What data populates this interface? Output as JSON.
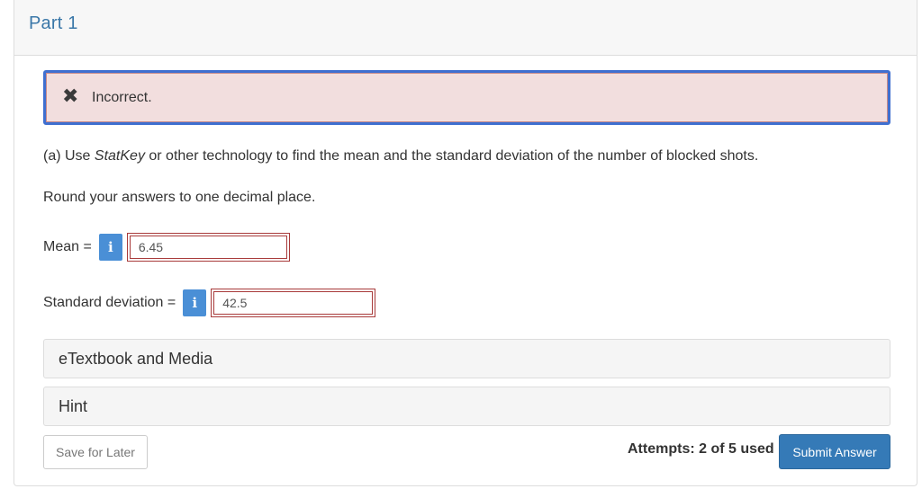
{
  "header": {
    "title": "Part 1"
  },
  "alert": {
    "icon": "close-icon",
    "text": "Incorrect."
  },
  "question": {
    "prefix": "(a) Use ",
    "emphasis": "StatKey",
    "suffix": " or other technology to find the mean and the standard deviation of the number of blocked shots.",
    "instruction": "Round your answers to one decimal place."
  },
  "fields": {
    "mean": {
      "label": "Mean =",
      "info_icon": "i",
      "value": "6.45"
    },
    "sd": {
      "label": "Standard deviation =",
      "info_icon": "i",
      "value": "42.5"
    }
  },
  "resources": {
    "etextbook_label": "eTextbook and Media",
    "hint_label": "Hint"
  },
  "footer": {
    "save_label": "Save for Later",
    "attempts_text": "Attempts: 2 of 5 used",
    "submit_label": "Submit Answer"
  },
  "colors": {
    "accent": "#357ab7",
    "error_bg": "#f2dede",
    "error_border": "#a83a3a",
    "info": "#4a8fd6"
  }
}
